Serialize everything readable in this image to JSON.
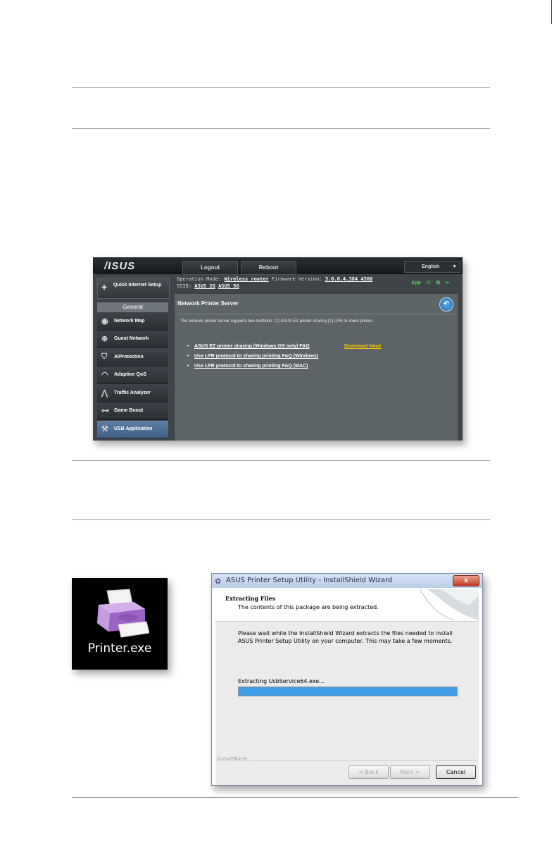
{
  "router": {
    "logo": "/ISUS",
    "logout": "Logout",
    "reboot": "Reboot",
    "language": "English",
    "op_mode_label": "Operation Mode:",
    "op_mode_value": "Wireless router",
    "fw_label": "Firmware Version:",
    "fw_value": "3.0.0.4.384_4360",
    "ssid_label": "SSID:",
    "ssid_1": "ASUS_2G",
    "ssid_2": "ASUS_5G",
    "app_label": "App",
    "quick_setup": "Quick Internet Setup",
    "general": "General",
    "nav": [
      "Network Map",
      "Guest Network",
      "AiProtection",
      "Adaptive QoS",
      "Traffic Analyzer",
      "Game Boost",
      "USB Application"
    ],
    "panel_title": "Network Printer Server",
    "panel_desc": "The network printer server supports two methods: (1) ASUS EZ printer sharing (2) LPR to share printer.",
    "links": [
      "ASUS EZ printer sharing (Windows OS only) FAQ",
      "Use LPR protocol to sharing printing FAQ (Windows)",
      "Use LPR protocol to sharing printing FAQ (MAC)"
    ],
    "download": "Download Now!"
  },
  "icon": {
    "label": "Printer.exe"
  },
  "installer": {
    "title": "ASUS Printer Setup Utility - InstallShield Wizard",
    "close": "x",
    "heading": "Extracting Files",
    "subheading": "The contents of this package are being extracted.",
    "message": "Please wait while the InstallShield Wizard extracts the files needed to install ASUS Printer Setup Utility on your computer.  This may take a few moments.",
    "status": "Extracting UsbService64.exe...",
    "progress": 1.0,
    "brand": "InstallShield",
    "back": "< Back",
    "next": "Next >",
    "cancel": "Cancel"
  }
}
